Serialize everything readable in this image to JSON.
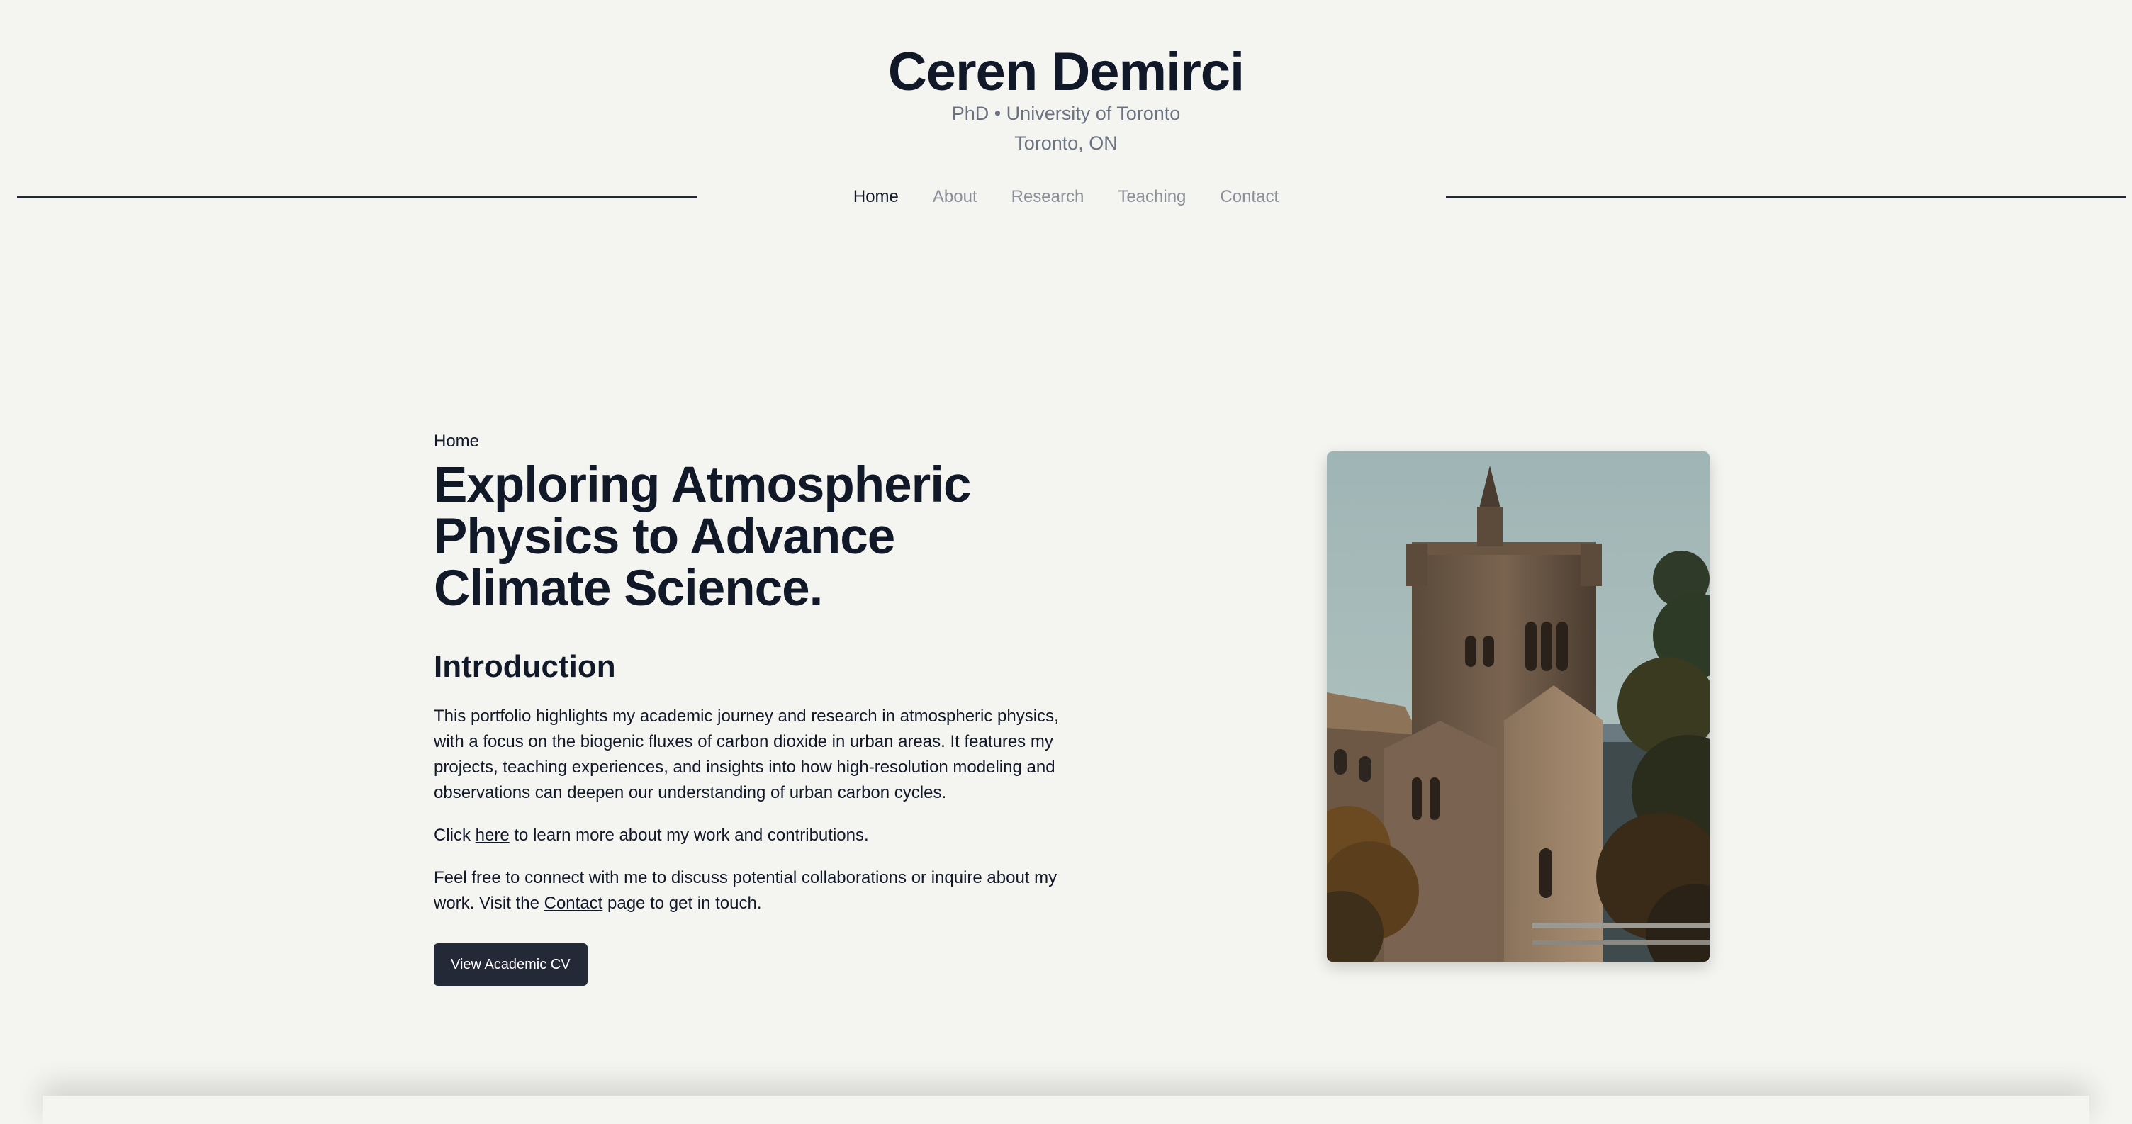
{
  "header": {
    "name": "Ceren Demirci",
    "degree": "PhD • University of Toronto",
    "location": "Toronto, ON"
  },
  "nav": {
    "items": [
      {
        "label": "Home",
        "active": true
      },
      {
        "label": "About",
        "active": false
      },
      {
        "label": "Research",
        "active": false
      },
      {
        "label": "Teaching",
        "active": false
      },
      {
        "label": "Contact",
        "active": false
      }
    ]
  },
  "main": {
    "breadcrumb": "Home",
    "title": "Exploring Atmospheric Physics to Advance Climate Science.",
    "intro_heading": "Introduction",
    "intro_paragraph": "This portfolio highlights my academic journey and research in atmospheric physics, with a focus on the biogenic fluxes of carbon dioxide in urban areas. It features my projects, teaching experiences, and insights into how high-resolution modeling and observations can deepen our understanding of urban carbon cycles.",
    "click_prefix": "Click ",
    "click_link": "here",
    "click_suffix": " to learn more about my work and contributions.",
    "connect_prefix": "Feel free to connect with me to discuss potential collaborations or inquire about my work. Visit the ",
    "connect_link": "Contact",
    "connect_suffix": " page to get in touch.",
    "cv_button": "View Academic CV"
  },
  "colors": {
    "background": "#f4f4f1",
    "text": "#111827",
    "muted": "#6b7280",
    "nav_inactive": "#8a8f98",
    "button": "#232937"
  },
  "icons": {
    "photo": "university-tower-photo"
  }
}
